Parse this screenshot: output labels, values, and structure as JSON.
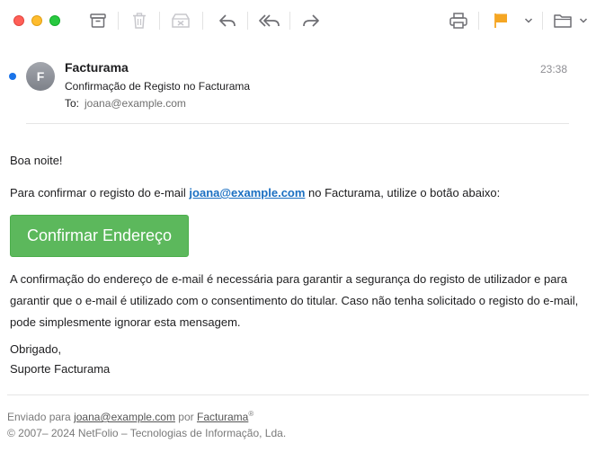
{
  "toolbar": {
    "icons": [
      "archive-icon",
      "trash-icon",
      "junk-icon",
      "reply-icon",
      "reply-all-icon",
      "forward-icon",
      "print-icon",
      "flag-icon",
      "chevron-down-icon",
      "folder-icon"
    ],
    "flag_color": "#f5a623"
  },
  "header": {
    "avatar_initial": "F",
    "sender": "Facturama",
    "subject": "Confirmação de Registo no Facturama",
    "to_label": "To:",
    "to_value": "joana@example.com",
    "time": "23:38"
  },
  "body": {
    "greeting": "Boa noite!",
    "para1_before": "Para confirmar o registo do e-mail ",
    "para1_link": "joana@example.com",
    "para1_after": " no Facturama, utilize o botão abaixo:",
    "button_label": "Confirmar Endereço",
    "para2": "A confirmação do endereço de e-mail é necessária para garantir a segurança do registo de utilizador e para garantir que o e-mail é utilizado com o consentimento do titular. Caso não tenha solicitado o registo do e-mail, pode simplesmente ignorar esta mensagem.",
    "thanks": "Obrigado,",
    "signature": "Suporte Facturama"
  },
  "footer": {
    "sent_to_prefix": "Enviado para ",
    "sent_to_email": "joana@example.com",
    "by": " por ",
    "brand": "Facturama",
    "reg_mark": "®",
    "copyright": "© 2007– 2024 NetFolio – Tecnologias de Informação, Lda."
  },
  "colors": {
    "button": "#5cb85c",
    "link": "#1a6fc2",
    "unread_dot": "#1a73e8"
  }
}
